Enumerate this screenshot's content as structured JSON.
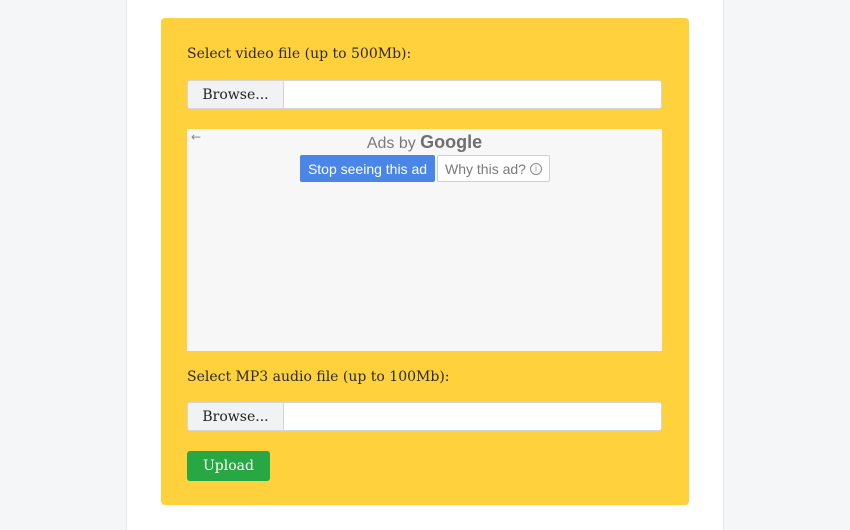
{
  "video": {
    "label": "Select video file (up to 500Mb):",
    "browse_label": "Browse...",
    "file_name": ""
  },
  "ad": {
    "back_icon": "←",
    "ads_by_prefix": "Ads by ",
    "ads_by_brand": "Google",
    "stop_label": "Stop seeing this ad",
    "why_label": "Why this ad?",
    "info_icon": "i"
  },
  "audio": {
    "label": "Select MP3 audio file (up to 100Mb):",
    "browse_label": "Browse...",
    "file_name": ""
  },
  "upload": {
    "label": "Upload"
  },
  "colors": {
    "card_background": "#ffd13c",
    "upload_button": "#28a745",
    "ad_primary_button": "#4a86e8"
  }
}
